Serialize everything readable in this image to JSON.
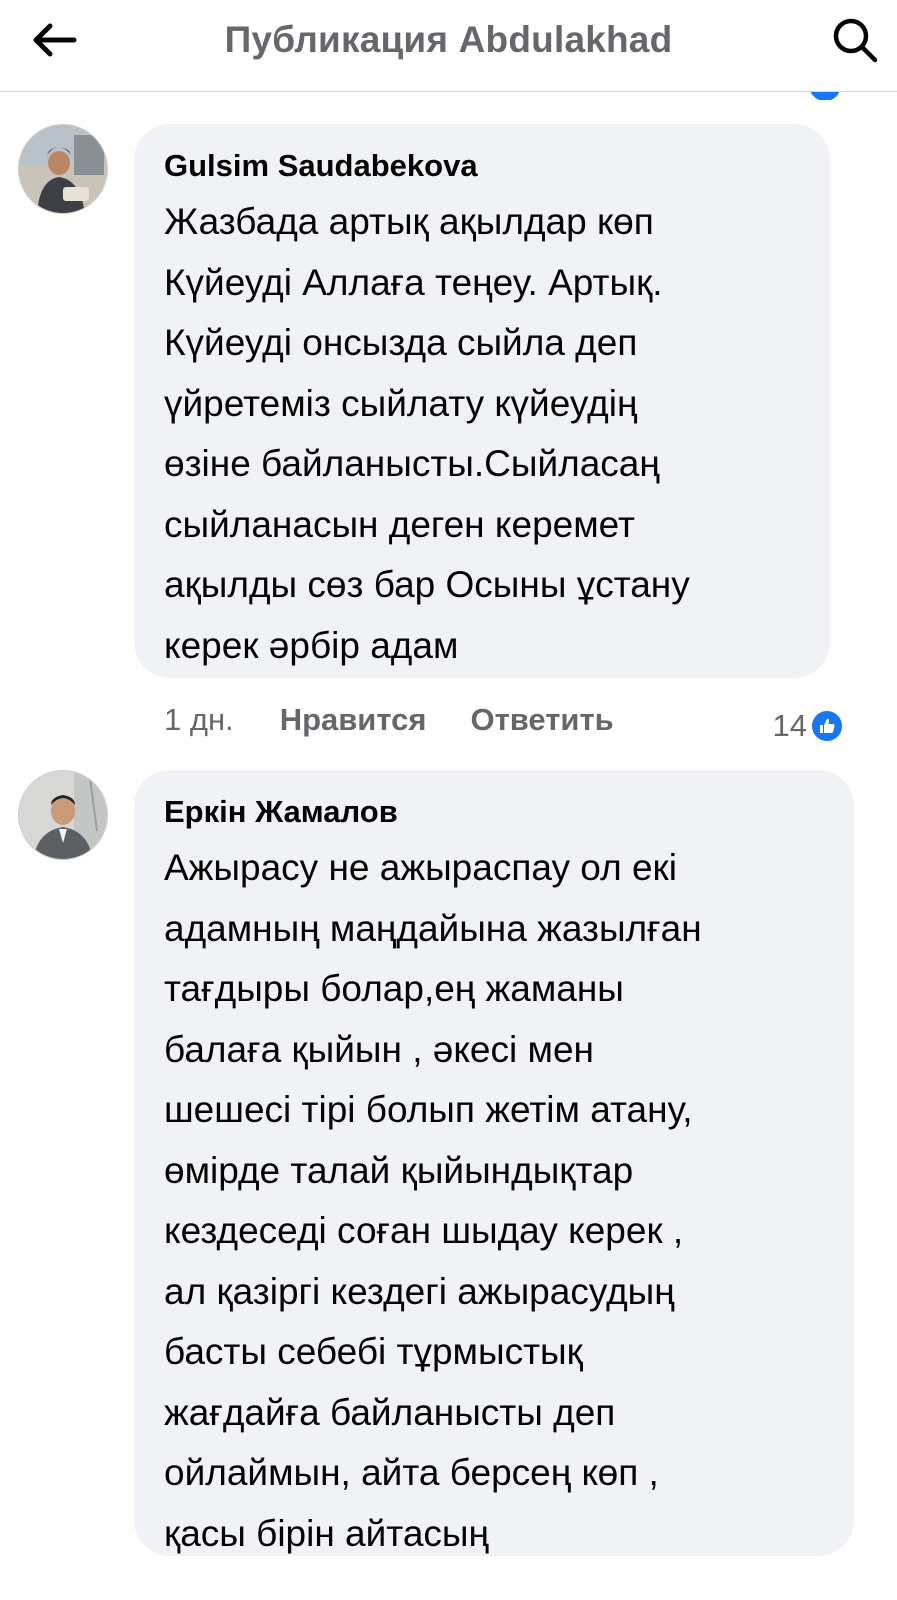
{
  "header": {
    "title": "Публикация Abdulakhad",
    "back_icon": "arrow-left-icon",
    "search_icon": "search-icon"
  },
  "comments": [
    {
      "author": "Gulsim Saudabekova",
      "avatar": "user-avatar",
      "lines": [
        "Жазбада артық ақылдар көп",
        "Күйеуді Аллаға теңеу. Артық.",
        "Күйеуді онсызда сыйла деп",
        "үйретеміз сыйлату күйеудің",
        "өзіне байланысты.Сыйласаң",
        "сыйланасын деген керемет",
        "ақылды сөз бар Осыны ұстану",
        "керек әрбір адам"
      ],
      "time": "1 дн.",
      "like_label": "Нравится",
      "reply_label": "Ответить",
      "reaction_count": "14",
      "reaction_icon": "like-icon"
    },
    {
      "author": "Еркін Жамалов",
      "avatar": "user-avatar",
      "lines": [
        "Ажырасу не ажыраспау ол екі",
        "адамның маңдайына жазылған",
        "тағдыры болар,ең жаманы",
        "балаға қыйын , әкесі мен",
        "шешесі тірі болып жетім атану,",
        "өмірде талай қыйындықтар",
        "кездеседі соған шыдау керек ,",
        "ал қазіргі кездегі ажырасудың",
        "басты себебі тұрмыстық",
        "жағдайға байланысты деп",
        "ойлаймын, айта берсең көп ,",
        "қасы бірін айтасың"
      ]
    }
  ],
  "colors": {
    "bubble": "#f0f2f5",
    "secondary_text": "#65676b",
    "like_blue": "#1877f2"
  }
}
